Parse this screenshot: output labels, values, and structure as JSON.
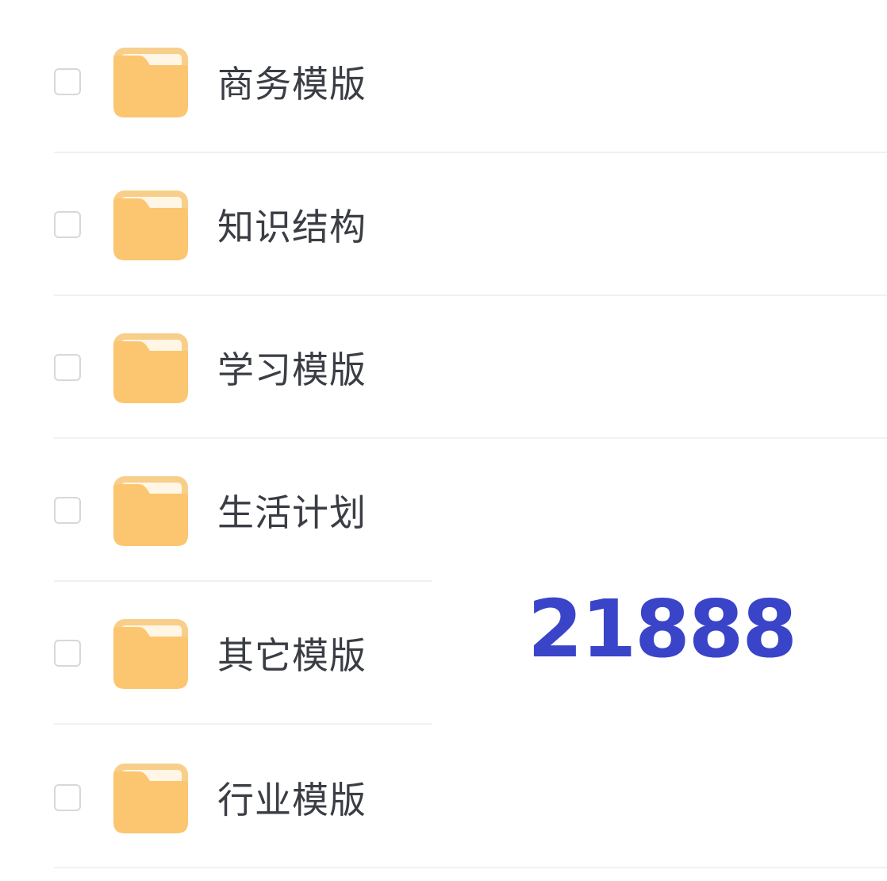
{
  "folders": [
    {
      "name": "商务模版"
    },
    {
      "name": "知识结构"
    },
    {
      "name": "学习模版"
    },
    {
      "name": "生活计划"
    },
    {
      "name": "其它模版"
    },
    {
      "name": "行业模版"
    }
  ],
  "overlay_number": "21888",
  "colors": {
    "folder_body": "#fbc66f",
    "folder_tab": "#f8cf8a",
    "folder_paper": "#fff6e6",
    "text": "#3b3d44",
    "overlay_number": "#3a44c9",
    "divider": "#f0f1f3",
    "checkbox_border": "#d6d8dc"
  },
  "icons": {
    "checkbox": "checkbox-icon",
    "folder": "folder-icon"
  }
}
